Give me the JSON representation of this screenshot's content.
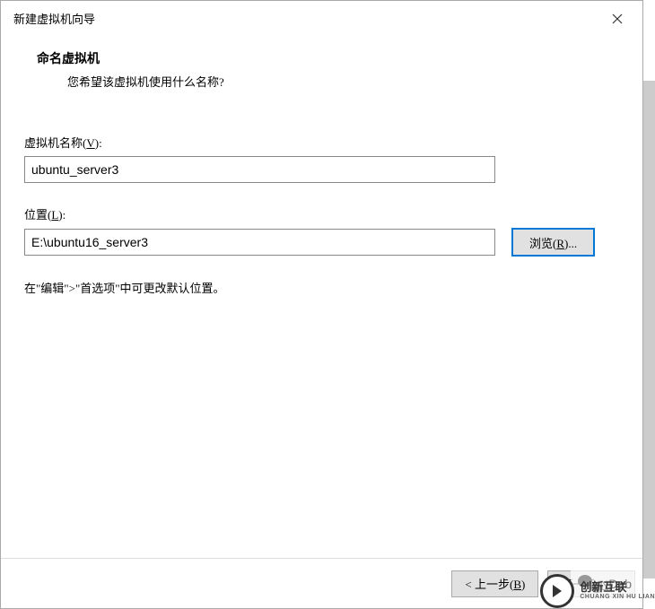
{
  "window": {
    "title": "新建虚拟机向导"
  },
  "header": {
    "title": "命名虚拟机",
    "subtitle": "您希望该虚拟机使用什么名称?"
  },
  "fields": {
    "vm_name": {
      "label_prefix": "虚拟机名称(",
      "label_key": "V",
      "label_suffix": "):",
      "value": "ubuntu_server3"
    },
    "location": {
      "label_prefix": "位置(",
      "label_key": "L",
      "label_suffix": "):",
      "value": "E:\\ubuntu16_server3",
      "browse_prefix": "浏览(",
      "browse_key": "R",
      "browse_suffix": ")..."
    }
  },
  "hint": "在\"编辑\">\"首选项\"中可更改默认位置。",
  "footer": {
    "back_prefix": "< 上一步(",
    "back_key": "B",
    "back_suffix": ")",
    "next_prefix": "下一步(",
    "next_key": "N",
    "next_suffix": ") >"
  },
  "overlay": {
    "debug_text": "Deb",
    "watermark_brand": "创新互联",
    "watermark_sub": "CHUANG XIN HU LIAN"
  }
}
